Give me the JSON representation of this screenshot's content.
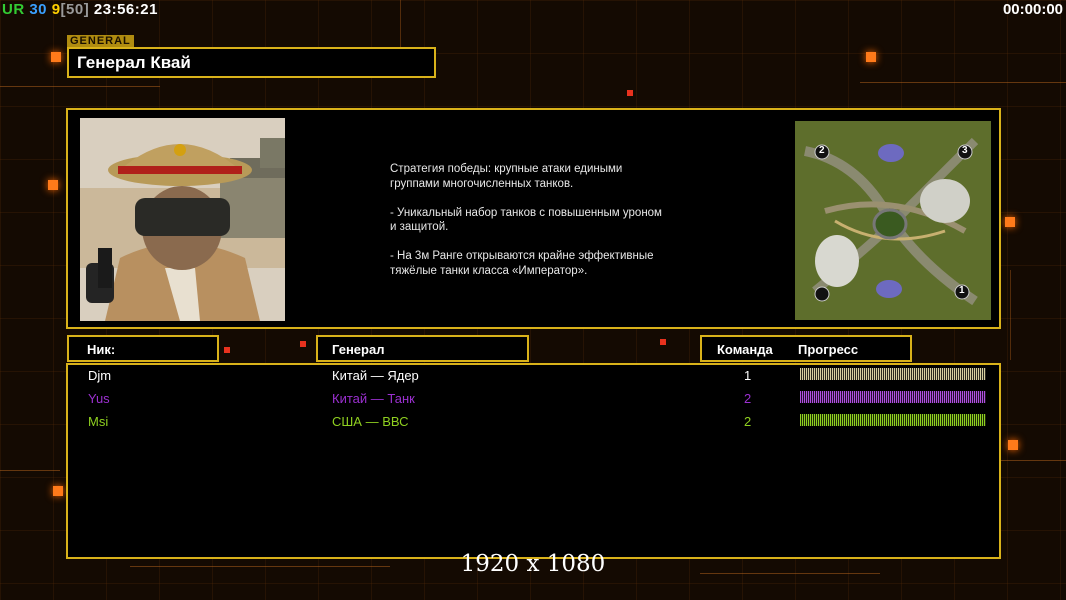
{
  "hud": {
    "ur_label": "UR",
    "fps": "30",
    "num": "9",
    "bracket_open": "[",
    "bracket_value": "50",
    "bracket_close": "]",
    "clock": "23:56:21",
    "timer": "00:00:00"
  },
  "general": {
    "tag": "GENERAL",
    "name": "Генерал Квай",
    "description": "Стратегия победы: крупные атаки едиными\n группами многочисленных танков.\n\n- Уникальный набор танков с повышенным уроном\n и защитой.\n\n- На 3м Ранге открываются крайне эффективные\n тяжёлые танки класса «Император»."
  },
  "minimap": {
    "spawns": [
      "2",
      "3",
      "1"
    ]
  },
  "columns": {
    "nick": "Ник:",
    "general": "Генерал",
    "team": "Команда",
    "progress": "Прогресс"
  },
  "players": [
    {
      "nick": "Djm",
      "general": "Китай — Ядер",
      "team": "1",
      "progress_pct": 100,
      "color": "#ffffff",
      "bar_color": "#d8d0a0"
    },
    {
      "nick": "Yus",
      "general": "Китай — Танк",
      "team": "2",
      "progress_pct": 100,
      "color": "#9b30d0",
      "bar_color": "#b050e0"
    },
    {
      "nick": "Msi",
      "general": "США — ВВС",
      "team": "2",
      "progress_pct": 100,
      "color": "#8fd020",
      "bar_color": "#8fd020"
    }
  ],
  "resolution": "1920 x 1080",
  "colors": {
    "accent": "#d9b21a",
    "hud_green": "#33cc33",
    "hud_blue": "#3aa0ff",
    "hud_yellow": "#ffd000",
    "hud_gray": "#9a9a9a"
  }
}
